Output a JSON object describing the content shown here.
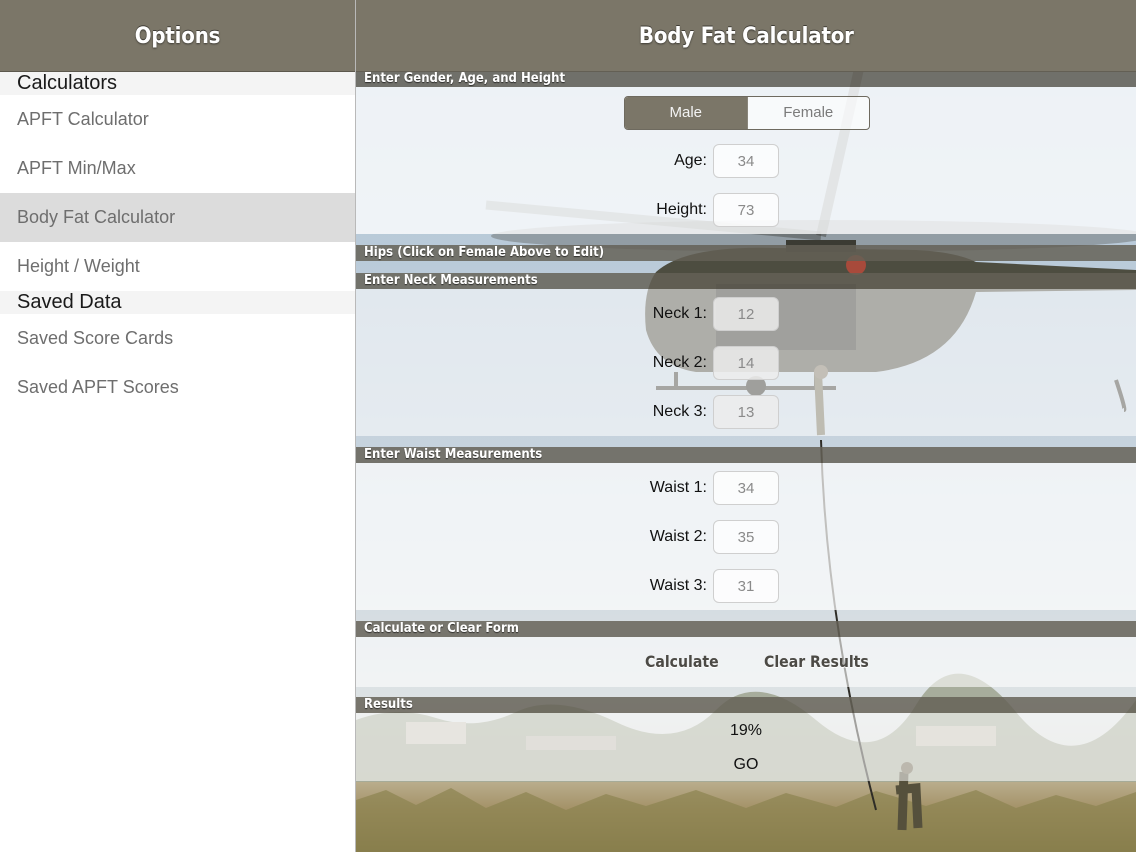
{
  "sidebar": {
    "title": "Options",
    "sections": [
      {
        "header": "Calculators",
        "items": [
          "APFT Calculator",
          "APFT Min/Max",
          "Body Fat Calculator",
          "Height / Weight"
        ]
      },
      {
        "header": "Saved Data",
        "items": [
          "Saved Score Cards",
          "Saved APFT Scores"
        ]
      }
    ],
    "selected_item": "Body Fat Calculator"
  },
  "main": {
    "title": "Body Fat Calculator",
    "sections": {
      "gender_age_height": "Enter Gender, Age, and Height",
      "hips": "Hips (Click on Female Above to Edit)",
      "neck": "Enter Neck Measurements",
      "waist": "Enter Waist Measurements",
      "calc": "Calculate or Clear Form",
      "results": "Results"
    },
    "gender": {
      "options": [
        "Male",
        "Female"
      ],
      "selected": "Male"
    },
    "fields": {
      "age": {
        "label": "Age:",
        "value": "34"
      },
      "height": {
        "label": "Height:",
        "value": "73"
      },
      "neck1": {
        "label": "Neck 1:",
        "value": "12"
      },
      "neck2": {
        "label": "Neck 2:",
        "value": "14"
      },
      "neck3": {
        "label": "Neck 3:",
        "value": "13"
      },
      "waist1": {
        "label": "Waist 1:",
        "value": "34"
      },
      "waist2": {
        "label": "Waist 2:",
        "value": "35"
      },
      "waist3": {
        "label": "Waist 3:",
        "value": "31"
      }
    },
    "buttons": {
      "calculate": "Calculate",
      "clear": "Clear Results"
    },
    "results": {
      "percent": "19%",
      "status": "GO"
    }
  },
  "colors": {
    "navbar": "#7b7668",
    "selected_row": "#dcdcdc",
    "strip": "#646056"
  },
  "icons": {
    "background": "helicopter-rappel-photo"
  }
}
